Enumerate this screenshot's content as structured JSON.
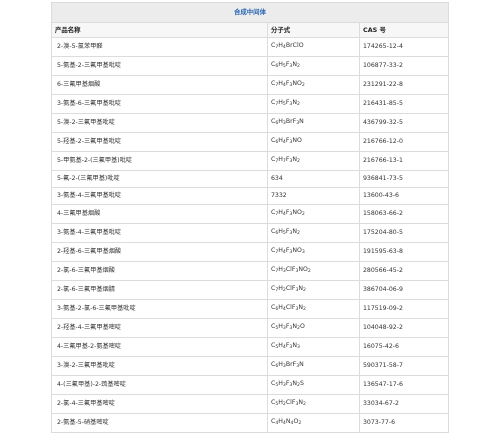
{
  "table": {
    "title": "合成中间体",
    "headers": [
      "产品名称",
      "分子式",
      "CAS 号"
    ],
    "rows": [
      {
        "name": "2-溴-5-氯苯甲醛",
        "formula": "C7H4BrClO",
        "cas": "174265-12-4"
      },
      {
        "name": "5-氨基-2-三氟甲基吡啶",
        "formula": "C6H5F3N2",
        "cas": "106877-33-2"
      },
      {
        "name": "6-三氟甲基烟酸",
        "formula": "C7H4F3NO2",
        "cas": "231291-22-8"
      },
      {
        "name": "3-氨基-6-三氟甲基吡啶",
        "formula": "C7H5F3N2",
        "cas": "216431-85-5"
      },
      {
        "name": "5-溴-2-三氟甲基吡啶",
        "formula": "C6H3BrF3N",
        "cas": "436799-32-5"
      },
      {
        "name": "5-羟基-2-三氟甲基吡啶",
        "formula": "C6H4F3NO",
        "cas": "216766-12-0"
      },
      {
        "name": "5-甲氨基-2-(三氟甲基)吡啶",
        "formula": "C7H7F3N2",
        "cas": "216766-13-1"
      },
      {
        "name": "5-氟-2-(三氟甲基)吡啶",
        "formula": "634",
        "cas": "936841-73-5"
      },
      {
        "name": "3-氨基-4-三氟甲基吡啶",
        "formula": "7332",
        "cas": "13600-43-6"
      },
      {
        "name": "4-三氟甲基烟酸",
        "formula": "C7H4F3NO2",
        "cas": "158063-66-2"
      },
      {
        "name": "3-氨基-4-三氟甲基吡啶",
        "formula": "C6H5F3N2",
        "cas": "175204-80-5"
      },
      {
        "name": "2-羟基-6-三氟甲基烟酸",
        "formula": "C7H4F3NO3",
        "cas": "191595-63-8"
      },
      {
        "name": "2-氯-6-三氟甲基烟酸",
        "formula": "C7H3ClF3NO2",
        "cas": "280566-45-2"
      },
      {
        "name": "2-氯-6-三氟甲基烟腈",
        "formula": "C7H2ClF3N2",
        "cas": "386704-06-9"
      },
      {
        "name": "3-氨基-2-氯-6-三氟甲基吡啶",
        "formula": "C6H4ClF3N2",
        "cas": "117519-09-2"
      },
      {
        "name": "2-羟基-4-三氟甲基嘧啶",
        "formula": "C5H3F3N2O",
        "cas": "104048-92-2"
      },
      {
        "name": "4-三氟甲基-2-氨基嘧啶",
        "formula": "C5H4F3N3",
        "cas": "16075-42-6"
      },
      {
        "name": "3-溴-2-三氟甲基吡啶",
        "formula": "C6H3BrF3N",
        "cas": "590371-58-7"
      },
      {
        "name": "4-(三氟甲基)-2-巯基嘧啶",
        "formula": "C5H3F3N2S",
        "cas": "136547-17-6"
      },
      {
        "name": "2-氯-4-三氟甲基嘧啶",
        "formula": "C5H2ClF3N2",
        "cas": "33034-67-2"
      },
      {
        "name": "2-氨基-5-硝基嘧啶",
        "formula": "C4H4N4O2",
        "cas": "3073-77-6"
      }
    ]
  }
}
